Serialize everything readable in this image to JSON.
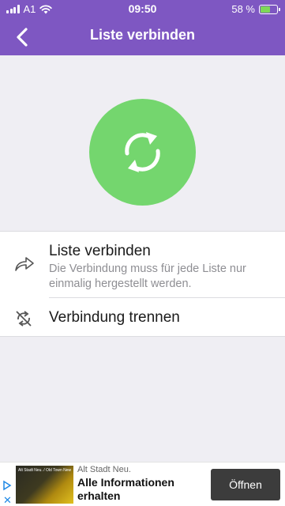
{
  "status_bar": {
    "carrier": "A1",
    "time": "09:50",
    "battery_percent": "58 %",
    "battery_level": 0.58
  },
  "nav": {
    "back_icon": "chevron-left-icon",
    "title": "Liste verbinden"
  },
  "hero": {
    "icon": "sync-icon",
    "accent_color": "#74d66e"
  },
  "actions": [
    {
      "icon": "share-arrow-icon",
      "title": "Liste verbinden",
      "description": "Die Verbindung muss für jede Liste nur einmalig hergestellt werden."
    },
    {
      "icon": "sync-off-icon",
      "title": "Verbindung trennen"
    }
  ],
  "ad": {
    "sponsor": "Alt Stadt Neu.",
    "headline": "Alle Informationen erhalten",
    "button_label": "Öffnen",
    "close_label": "✕",
    "image_text": "Alt Stadt Neu. / Old Town New"
  },
  "colors": {
    "header": "#7e57c2",
    "background": "#efeef3"
  }
}
